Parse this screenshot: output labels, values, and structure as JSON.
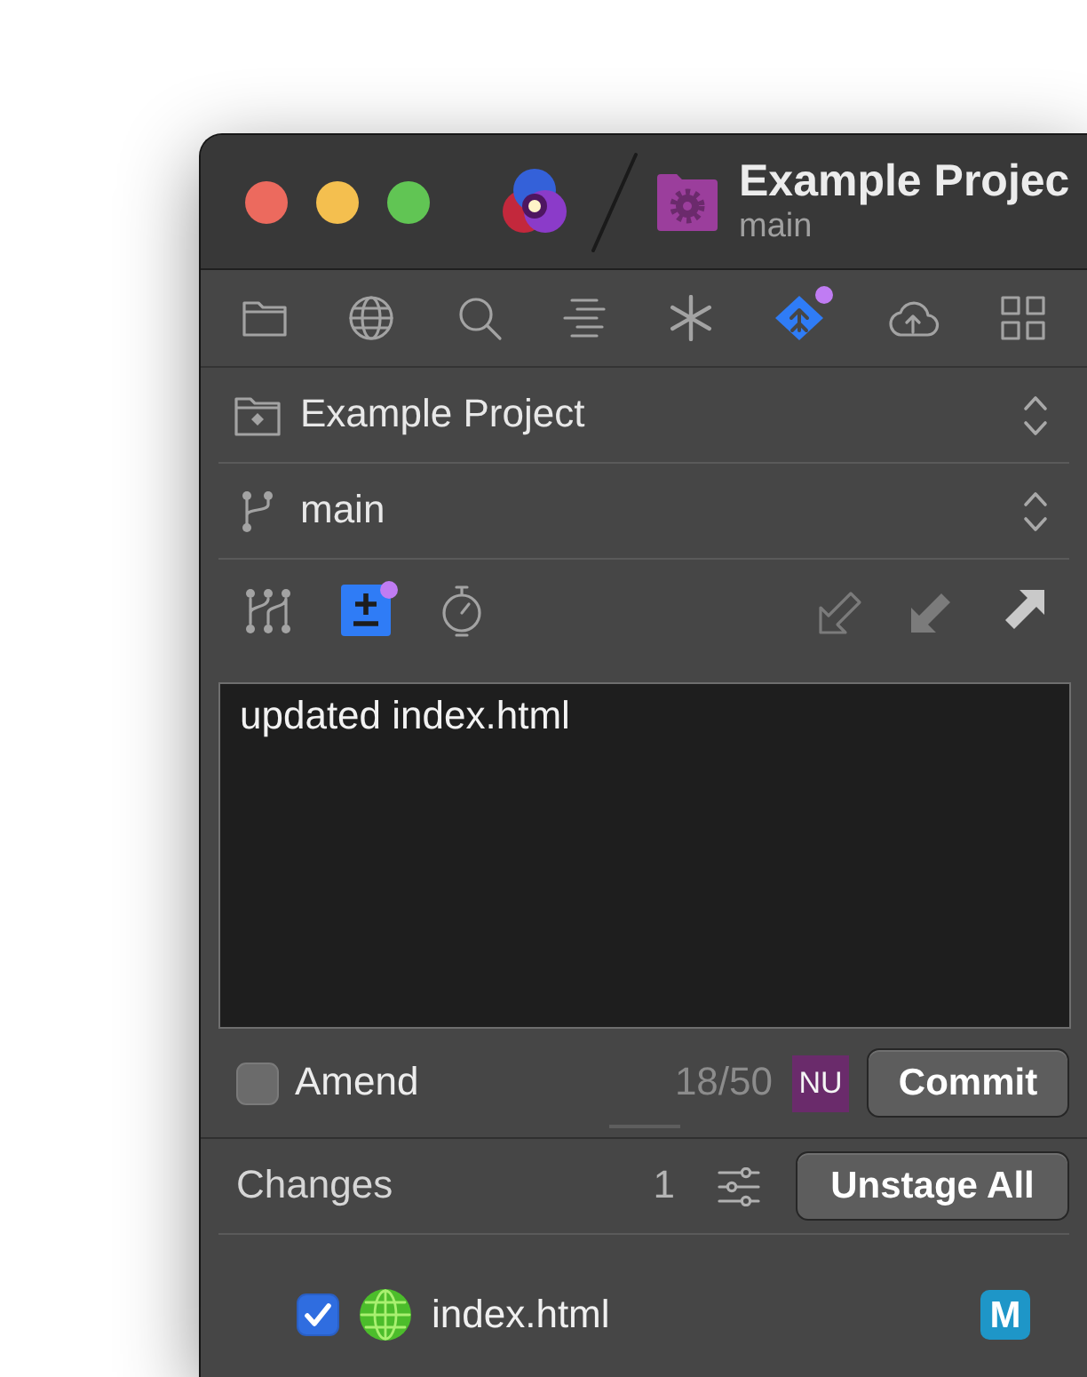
{
  "window": {
    "title": "Example Projec",
    "subtitle": "main"
  },
  "navigator": [
    {
      "kind": "folder",
      "selected": false,
      "notification": false
    },
    {
      "kind": "globe",
      "selected": false,
      "notification": false
    },
    {
      "kind": "search",
      "selected": false,
      "notification": false
    },
    {
      "kind": "lines",
      "selected": false,
      "notification": false
    },
    {
      "kind": "asterisk",
      "selected": false,
      "notification": false
    },
    {
      "kind": "source-control",
      "selected": true,
      "notification": true
    },
    {
      "kind": "cloud",
      "selected": false,
      "notification": false
    },
    {
      "kind": "grid",
      "selected": false,
      "notification": false
    }
  ],
  "project": {
    "name": "Example Project"
  },
  "branch": {
    "name": "main"
  },
  "commit_tools": [
    {
      "kind": "graph",
      "selected": false,
      "notification": false
    },
    {
      "kind": "stage",
      "selected": true,
      "notification": true
    },
    {
      "kind": "timer",
      "selected": false,
      "notification": false
    }
  ],
  "sync_actions": [
    {
      "kind": "fetch",
      "disabled": true
    },
    {
      "kind": "pull",
      "disabled": true
    },
    {
      "kind": "push",
      "disabled": false
    }
  ],
  "commit": {
    "message": "updated index.html",
    "amend": {
      "label": "Amend",
      "checked": false
    },
    "char_count": "18/50",
    "author_initials": "NU",
    "button": "Commit"
  },
  "changes": {
    "title": "Changes",
    "count": "1",
    "button": "Unstage All",
    "files": [
      {
        "name": "index.html",
        "checked": true,
        "status": "M",
        "color": "#1e96c8"
      }
    ]
  }
}
